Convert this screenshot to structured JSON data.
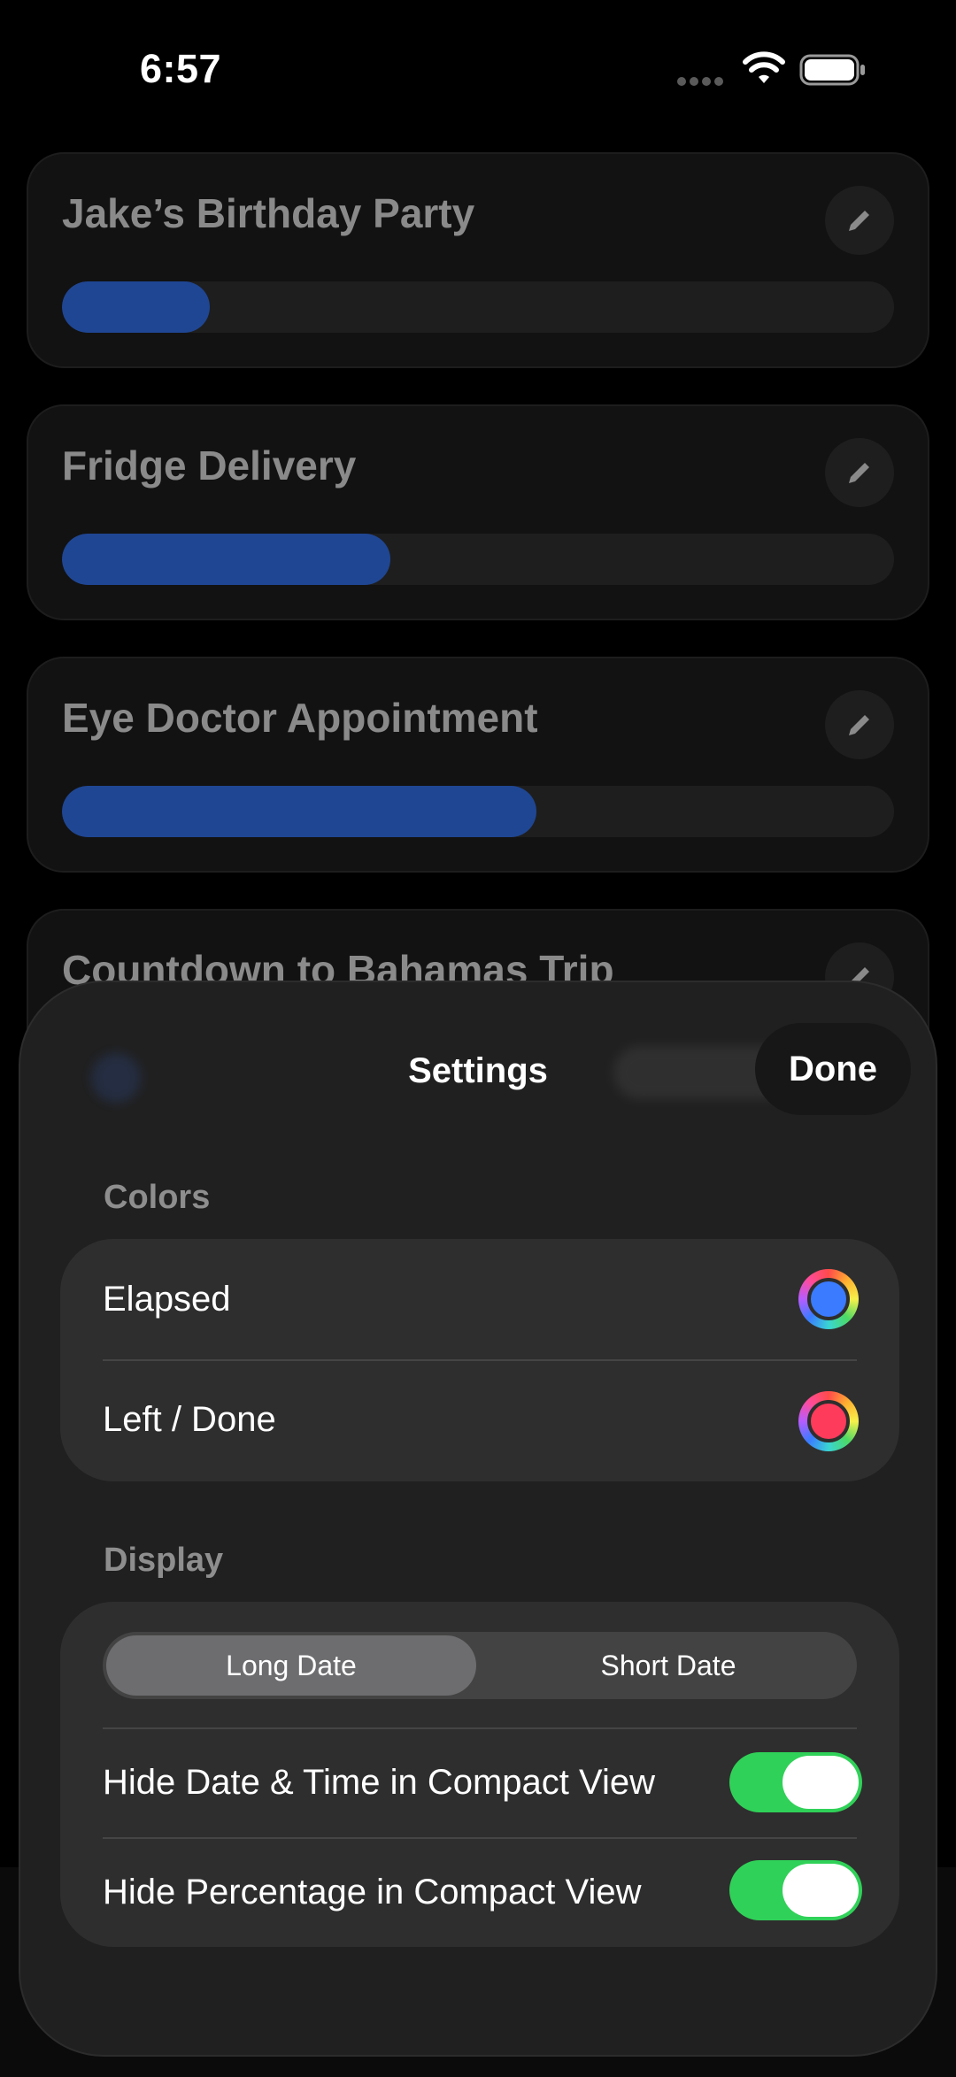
{
  "status_bar": {
    "time": "6:57"
  },
  "cards": [
    {
      "title": "Jake’s Birthday Party",
      "progress": 0.178
    },
    {
      "title": "Fridge Delivery",
      "progress": 0.395
    },
    {
      "title": "Eye Doctor Appointment",
      "progress": 0.57
    },
    {
      "title": "Countdown to Bahamas Trip",
      "progress": 0.0
    }
  ],
  "settings": {
    "title": "Settings",
    "done_label": "Done",
    "colors_section": {
      "label": "Colors",
      "elapsed_label": "Elapsed",
      "elapsed_color": "#3a7bff",
      "left_done_label": "Left / Done",
      "left_done_color": "#ff3b5c"
    },
    "display_section": {
      "label": "Display",
      "segments": [
        "Long Date",
        "Short Date"
      ],
      "selected_segment": "Long Date",
      "hide_date_time_label": "Hide Date & Time in Compact View",
      "hide_date_time_on": true,
      "hide_percentage_label": "Hide Percentage in Compact View",
      "hide_percentage_on": true
    }
  },
  "colors": {
    "progress_fill": "#1f4693",
    "toggle_on": "#30d158"
  }
}
